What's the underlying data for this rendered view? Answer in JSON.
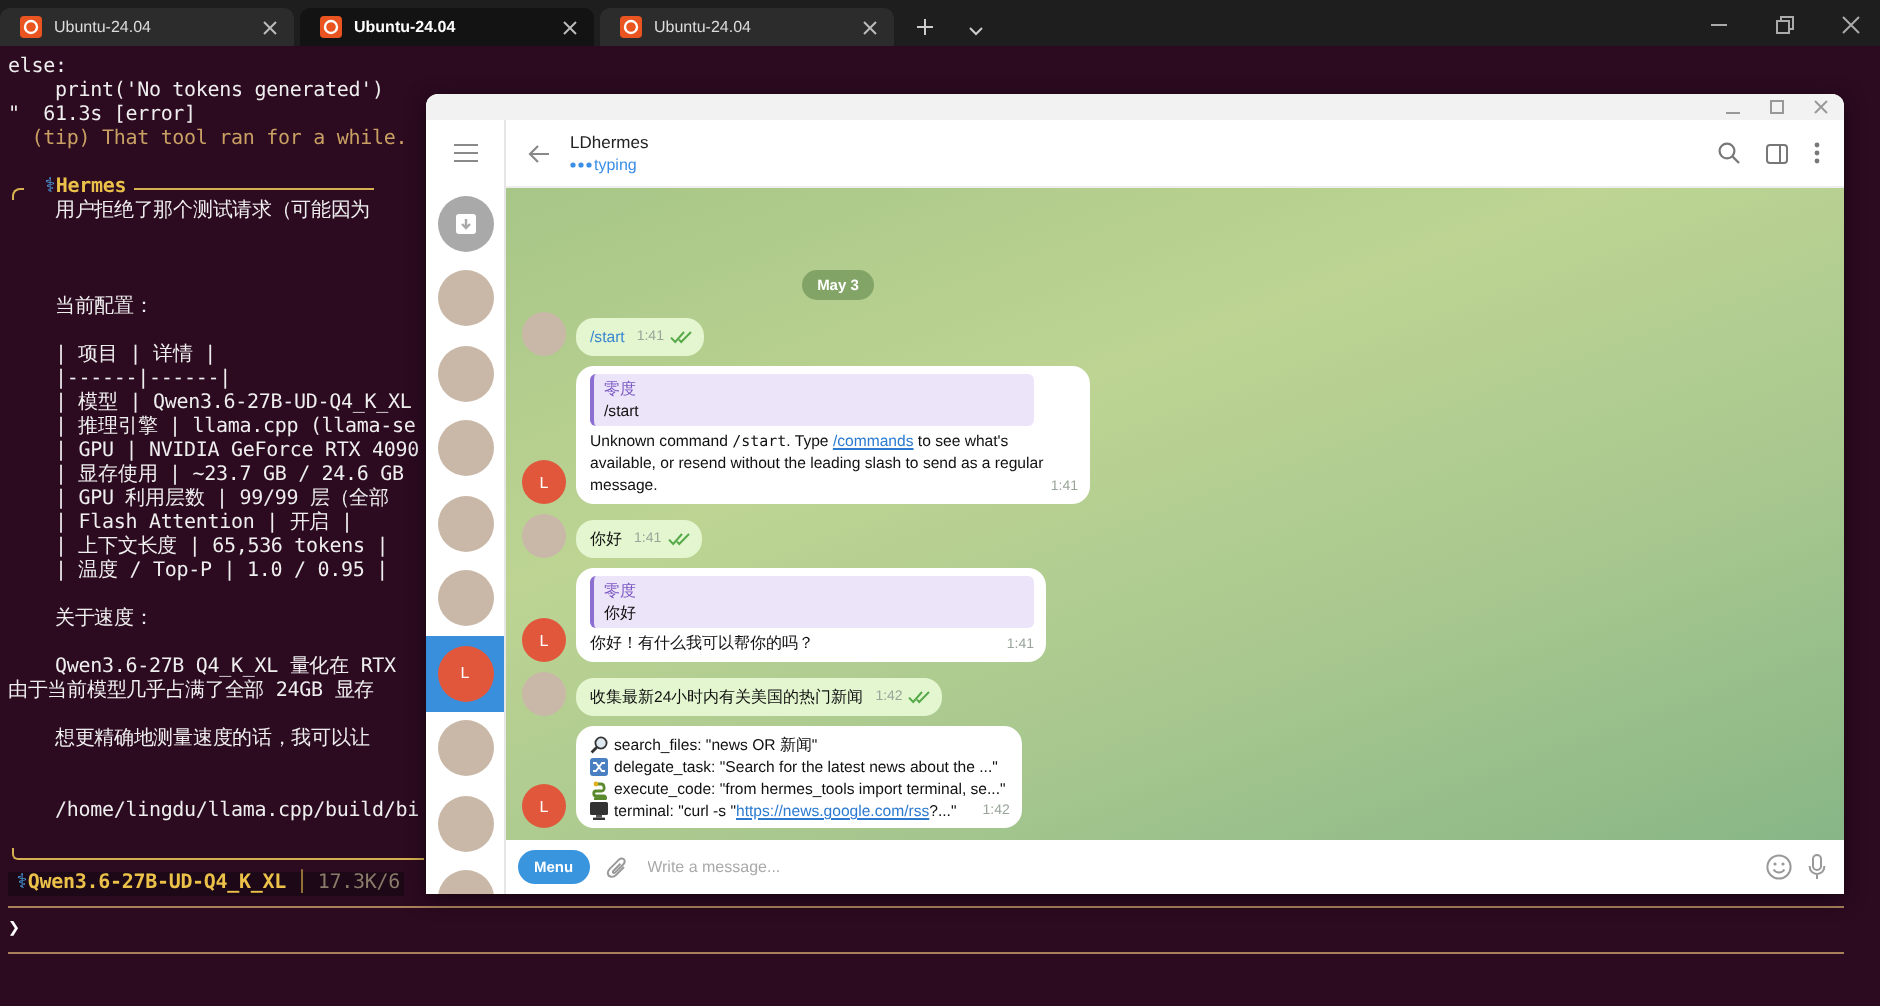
{
  "tabs": [
    {
      "label": "Ubuntu-24.04",
      "selected": false
    },
    {
      "label": "Ubuntu-24.04",
      "selected": true
    },
    {
      "label": "Ubuntu-24.04",
      "selected": false
    }
  ],
  "terminal": {
    "lines": [
      {
        "kind": "code",
        "text": "else:"
      },
      {
        "kind": "code",
        "text": "    print('No tokens generated')"
      },
      {
        "kind": "code",
        "text": "\"  61.3s [error]"
      },
      {
        "kind": "tip",
        "text": "  (tip) That tool ran for a while."
      },
      {
        "kind": "blank"
      }
    ],
    "panel": {
      "icon": "⚕",
      "title": "Hermes",
      "lines": [
        {
          "kind": "code",
          "text": "    用户拒绝了那个测试请求（可能因为"
        },
        {
          "kind": "blank"
        },
        {
          "kind": "blank"
        },
        {
          "kind": "blank"
        },
        {
          "kind": "code",
          "text": "    当前配置："
        },
        {
          "kind": "blank"
        },
        {
          "kind": "code",
          "text": "    | 项目 | 详情 |"
        },
        {
          "kind": "code",
          "text": "    |------|------|"
        },
        {
          "kind": "code",
          "text": "    | 模型 | Qwen3.6-27B-UD-Q4_K_XL"
        },
        {
          "kind": "code",
          "text": "    | 推理引擎 | llama.cpp (llama-se"
        },
        {
          "kind": "code",
          "text": "    | GPU | NVIDIA GeForce RTX 4090"
        },
        {
          "kind": "code",
          "text": "    | 显存使用 | ~23.7 GB / 24.6 GB"
        },
        {
          "kind": "code",
          "text": "    | GPU 利用层数 | 99/99 层（全部"
        },
        {
          "kind": "code",
          "text": "    | Flash Attention | 开启 |"
        },
        {
          "kind": "code",
          "text": "    | 上下文长度 | 65,536 tokens |"
        },
        {
          "kind": "code",
          "text": "    | 温度 / Top-P | 1.0 / 0.95 |"
        },
        {
          "kind": "blank"
        },
        {
          "kind": "code",
          "text": "    关于速度："
        },
        {
          "kind": "blank"
        },
        {
          "kind": "code",
          "text": "    Qwen3.6-27B Q4_K_XL 量化在 RTX"
        },
        {
          "kind": "code",
          "text": "由于当前模型几乎占满了全部 24GB 显存"
        },
        {
          "kind": "blank"
        },
        {
          "kind": "code",
          "text": "    想更精确地测量速度的话，我可以让"
        },
        {
          "kind": "blank"
        },
        {
          "kind": "blank"
        },
        {
          "kind": "code",
          "text": "    /home/lingdu/llama.cpp/build/bi"
        },
        {
          "kind": "blank"
        }
      ]
    },
    "status": {
      "icon": "⚕",
      "model": "Qwen3.6-27B-UD-Q4_K_XL",
      "separator": "│",
      "usage": "17.3K/6"
    },
    "prompt": "❯"
  },
  "telegram": {
    "chat": {
      "title": "LDhermes",
      "status": "typing"
    },
    "sidebar": [
      {
        "kind": "archive",
        "selected": false
      },
      {
        "kind": "photo",
        "selected": false
      },
      {
        "kind": "photo",
        "selected": false
      },
      {
        "kind": "photo",
        "selected": false
      },
      {
        "kind": "photo",
        "selected": false
      },
      {
        "kind": "photo",
        "selected": false
      },
      {
        "kind": "letter",
        "letter": "L",
        "selected": true
      },
      {
        "kind": "photo",
        "selected": false
      },
      {
        "kind": "photo",
        "selected": false
      },
      {
        "kind": "photo",
        "selected": false
      }
    ],
    "date": "May 3",
    "messages": [
      {
        "kind": "outgoing",
        "read": true,
        "time": "1:41",
        "parts": [
          {
            "kind": "command",
            "text": "/start"
          }
        ]
      },
      {
        "kind": "incoming",
        "read": false,
        "sender_initial": "L",
        "time": "1:41",
        "reply": {
          "author": "零度",
          "text": "/start"
        },
        "parts": [
          {
            "kind": "text",
            "text": "Unknown command "
          },
          {
            "kind": "code",
            "text": "/start"
          },
          {
            "kind": "text",
            "text": ". Type "
          },
          {
            "kind": "link",
            "text": "/commands"
          },
          {
            "kind": "text",
            "text": " to see what's available, or resend without the leading slash to send as a regular message."
          }
        ]
      },
      {
        "kind": "outgoing",
        "read": true,
        "time": "1:41",
        "parts": [
          {
            "kind": "text",
            "text": "你好"
          }
        ]
      },
      {
        "kind": "incoming",
        "read": false,
        "sender_initial": "L",
        "time": "1:41",
        "reply": {
          "author": "零度",
          "text": "你好"
        },
        "parts": [
          {
            "kind": "text",
            "text": "你好！有什么我可以帮你的吗？"
          }
        ]
      },
      {
        "kind": "outgoing",
        "read": true,
        "time": "1:42",
        "parts": [
          {
            "kind": "text",
            "text": "收集最新24小时内有关美国的热门新闻"
          }
        ]
      },
      {
        "kind": "incoming",
        "read": false,
        "sender_initial": "L",
        "time": "1:42",
        "lines": [
          {
            "kind": "search",
            "parts": [
              {
                "kind": "text",
                "text": "search_files: \"news OR 新闻\""
              }
            ]
          },
          {
            "kind": "delegate",
            "parts": [
              {
                "kind": "text",
                "text": "delegate_task: \"Search for the latest news about the ...\""
              }
            ]
          },
          {
            "kind": "code",
            "parts": [
              {
                "kind": "text",
                "text": "execute_code: \"from hermes_tools import terminal, se...\""
              }
            ]
          },
          {
            "kind": "terminal",
            "parts": [
              {
                "kind": "text",
                "text": "terminal: \"curl -s \""
              },
              {
                "kind": "link",
                "text": "https://news.google.com/rss"
              },
              {
                "kind": "text",
                "text": "?...\""
              }
            ]
          }
        ]
      }
    ],
    "composer": {
      "menu": "Menu",
      "placeholder": "Write a message..."
    }
  }
}
